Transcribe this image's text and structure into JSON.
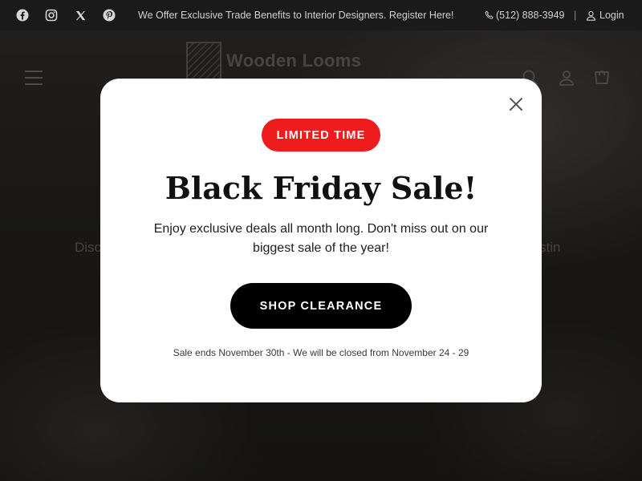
{
  "topbar": {
    "social": [
      {
        "name": "facebook-icon"
      },
      {
        "name": "instagram-icon"
      },
      {
        "name": "x-icon"
      },
      {
        "name": "pinterest-icon"
      }
    ],
    "announcement": "We Offer Exclusive Trade Benefits to Interior Designers. Register Here!",
    "phone": "(512) 888-3949",
    "separator": "|",
    "login_label": "Login"
  },
  "header": {
    "logo_text": "Wooden Looms",
    "icons": [
      "menu-icon",
      "search-icon",
      "account-icon",
      "cart-icon"
    ]
  },
  "hero": {
    "text_left_fragment": "Disc",
    "text_right_fragment": "stin"
  },
  "modal": {
    "badge": "LIMITED TIME",
    "title": "Black Friday Sale!",
    "description": "Enjoy exclusive deals all month long. Don't miss out on our biggest sale of the year!",
    "cta_label": "SHOP CLEARANCE",
    "footnote": "Sale ends November 30th - We will be closed from November 24 - 29"
  },
  "colors": {
    "badge_bg": "#ee1c1c",
    "cta_bg": "#000000",
    "topbar_bg": "#1a1a1a",
    "modal_bg": "#ffffff"
  }
}
